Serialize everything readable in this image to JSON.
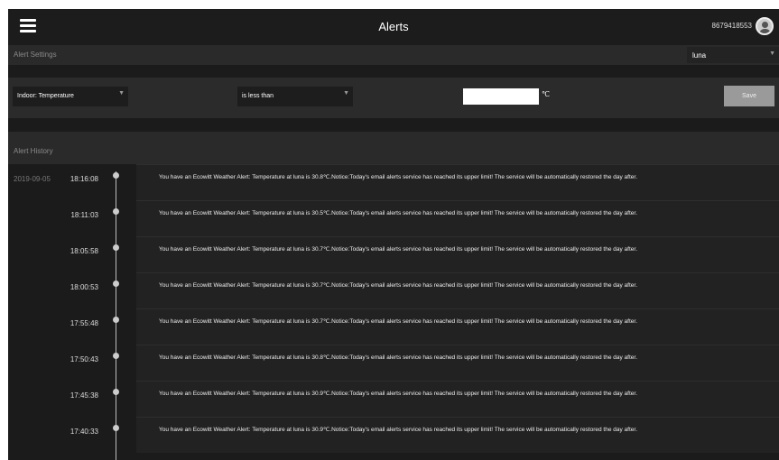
{
  "header": {
    "title": "Alerts",
    "account": "8679418553",
    "menu_icon": "hamburger-menu-icon",
    "avatar_icon": "user-avatar-icon"
  },
  "settings": {
    "title": "Alert Settings",
    "station": "luna",
    "sensor": "Indoor: Temperature",
    "condition": "is less than",
    "value": "",
    "unit": "℃",
    "save_label": "Save"
  },
  "history": {
    "title": "Alert History",
    "entries": [
      {
        "date": "2019-09-05",
        "time": "18:16:08",
        "message": "You have an Ecowitt Weather Alert: Temperature at luna is 30.8℃.Notice:Today's email alerts service has reached its upper limit! The service will be automatically restored the day after."
      },
      {
        "date": "",
        "time": "18:11:03",
        "message": "You have an Ecowitt Weather Alert: Temperature at luna is 30.5℃.Notice:Today's email alerts service has reached its upper limit! The service will be automatically restored the day after."
      },
      {
        "date": "",
        "time": "18:05:58",
        "message": "You have an Ecowitt Weather Alert: Temperature at luna is 30.7℃.Notice:Today's email alerts service has reached its upper limit! The service will be automatically restored the day after."
      },
      {
        "date": "",
        "time": "18:00:53",
        "message": "You have an Ecowitt Weather Alert: Temperature at luna is 30.7℃.Notice:Today's email alerts service has reached its upper limit! The service will be automatically restored the day after."
      },
      {
        "date": "",
        "time": "17:55:48",
        "message": "You have an Ecowitt Weather Alert: Temperature at luna is 30.7℃.Notice:Today's email alerts service has reached its upper limit! The service will be automatically restored the day after."
      },
      {
        "date": "",
        "time": "17:50:43",
        "message": "You have an Ecowitt Weather Alert: Temperature at luna is 30.8℃.Notice:Today's email alerts service has reached its upper limit! The service will be automatically restored the day after."
      },
      {
        "date": "",
        "time": "17:45:38",
        "message": "You have an Ecowitt Weather Alert: Temperature at luna is 30.9℃.Notice:Today's email alerts service has reached its upper limit! The service will be automatically restored the day after."
      },
      {
        "date": "",
        "time": "17:40:33",
        "message": "You have an Ecowitt Weather Alert: Temperature at luna is 30.9℃.Notice:Today's email alerts service has reached its upper limit! The service will be automatically restored the day after."
      }
    ]
  }
}
